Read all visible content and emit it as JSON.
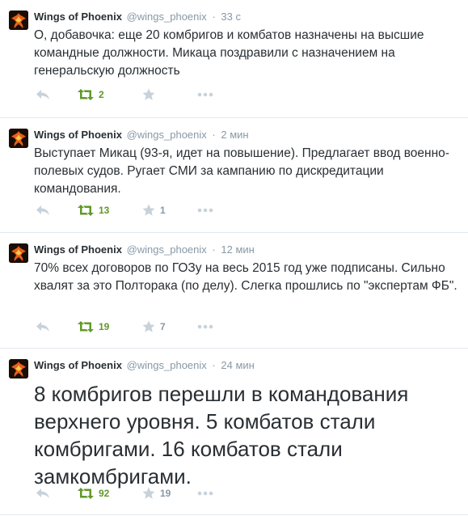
{
  "tweets": [
    {
      "fullname": "Wings of Phoenix",
      "username": "@wings_phoenix",
      "time": "33 с",
      "text": "О, добавочка: еще 20 комбригов и комбатов назначены на высшие командные должности. Микаца поздравили с назначением на генеральскую должность",
      "retweets": "2",
      "favorites": ""
    },
    {
      "fullname": "Wings of Phoenix",
      "username": "@wings_phoenix",
      "time": "2 мин",
      "text": "Выступает Микац (93-я, идет на повышение). Предлагает ввод военно-полевых судов. Ругает СМИ за кампанию по дискредитации командования.",
      "retweets": "13",
      "favorites": "1"
    },
    {
      "fullname": "Wings of Phoenix",
      "username": "@wings_phoenix",
      "time": "12 мин",
      "text": "70% всех договоров по ГОЗу на весь 2015 год уже подписаны. Сильно хвалят за это Полторака (по делу). Слегка прошлись по \"экспертам ФБ\".",
      "retweets": "19",
      "favorites": "7"
    },
    {
      "fullname": "Wings of Phoenix",
      "username": "@wings_phoenix",
      "time": "24 мин",
      "text": "8 комбригов перешли в командования верхнего уровня. 5 комбатов стали комбригами. 16 комбатов стали замкомбригами.",
      "retweets": "92",
      "favorites": "19"
    }
  ],
  "icons": {
    "reply": "reply-icon",
    "retweet": "retweet-icon",
    "favorite": "star-icon",
    "more": "more-dots-icon",
    "avatar": "phoenix-avatar"
  },
  "colors": {
    "retweeted": "#609928",
    "muted": "#8899a6",
    "icon": "#c8d2da",
    "text": "#292f33"
  }
}
